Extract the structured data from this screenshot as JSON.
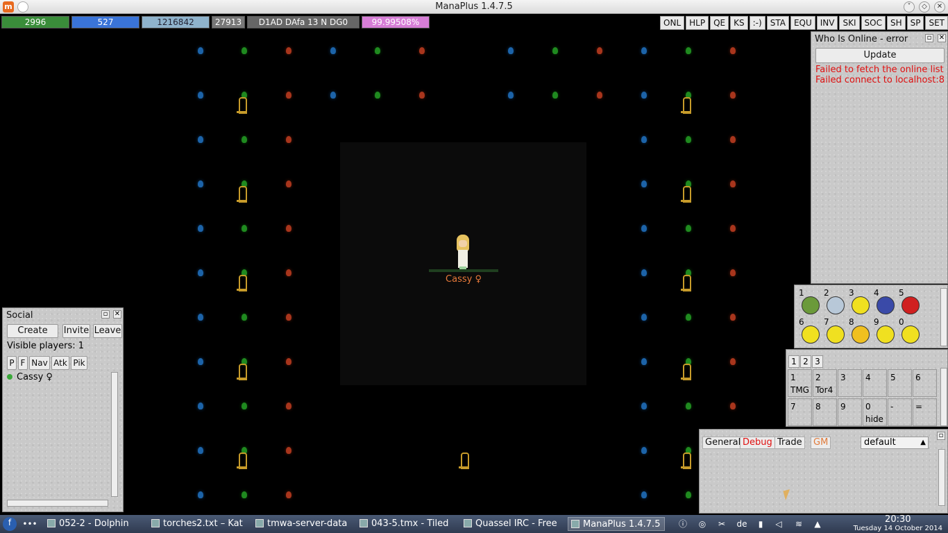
{
  "window": {
    "title": "ManaPlus 1.4.7.5"
  },
  "hud": {
    "hp": "2996",
    "mp": "527",
    "xp": "1216842",
    "money": "27913",
    "status": "D1AD DAfa 13 N DG0",
    "job": "99.99508%"
  },
  "shortcut_buttons": [
    "ONL",
    "HLP",
    "QE",
    "KS",
    ":-)",
    "STA",
    "EQU",
    "INV",
    "SKI",
    "SOC",
    "SH",
    "SP",
    "SET"
  ],
  "player": {
    "name": "Cassy ♀"
  },
  "online": {
    "title": "Who Is Online - error",
    "update_label": "Update",
    "errors": [
      "Failed to fetch the online list!",
      "Failed connect to localhost:8"
    ]
  },
  "emotes": [
    {
      "num": "1",
      "color": "#6b9a3a"
    },
    {
      "num": "2",
      "color": "#b8c8d8"
    },
    {
      "num": "3",
      "color": "#f0e020"
    },
    {
      "num": "4",
      "color": "#3a4aa8"
    },
    {
      "num": "5",
      "color": "#d02020"
    },
    {
      "num": "6",
      "color": "#f0e020"
    },
    {
      "num": "7",
      "color": "#f0e020"
    },
    {
      "num": "8",
      "color": "#f0c020"
    },
    {
      "num": "9",
      "color": "#f0e020"
    },
    {
      "num": "0",
      "color": "#f0e020"
    }
  ],
  "item_shortcuts": {
    "tabs": [
      "1",
      "2",
      "3"
    ],
    "slots": [
      {
        "key": "1",
        "label": "TMG"
      },
      {
        "key": "2",
        "label": "Tor4"
      },
      {
        "key": "3",
        "label": ""
      },
      {
        "key": "4",
        "label": ""
      },
      {
        "key": "5",
        "label": ""
      },
      {
        "key": "6",
        "label": ""
      },
      {
        "key": "7",
        "label": ""
      },
      {
        "key": "8",
        "label": ""
      },
      {
        "key": "9",
        "label": ""
      },
      {
        "key": "0",
        "label": "hide"
      },
      {
        "key": "-",
        "label": ""
      },
      {
        "key": "=",
        "label": ""
      }
    ]
  },
  "chat": {
    "tabs": [
      {
        "label": "General",
        "color": "#111111"
      },
      {
        "label": "Debug",
        "color": "#e01010"
      },
      {
        "label": "Trade",
        "color": "#111111"
      },
      {
        "label": "GM",
        "color": "#e07a3a"
      }
    ],
    "combo": "default"
  },
  "social": {
    "title": "Social",
    "create": "Create",
    "invite": "Invite",
    "leave": "Leave",
    "visible_players": "Visible players: 1",
    "tabs": [
      "P",
      "F",
      "Nav",
      "Atk",
      "Pik"
    ],
    "players": [
      "Cassy ♀"
    ]
  },
  "taskbar": {
    "items": [
      "052-2 - Dolphin",
      "torches2.txt – Kat",
      "tmwa-server-data",
      "043-5.tmx - Tiled",
      "Quassel IRC - Free",
      "ManaPlus 1.4.7.5"
    ],
    "lang": "de",
    "time": "20:30",
    "date": "Tuesday 14 October 2014"
  }
}
